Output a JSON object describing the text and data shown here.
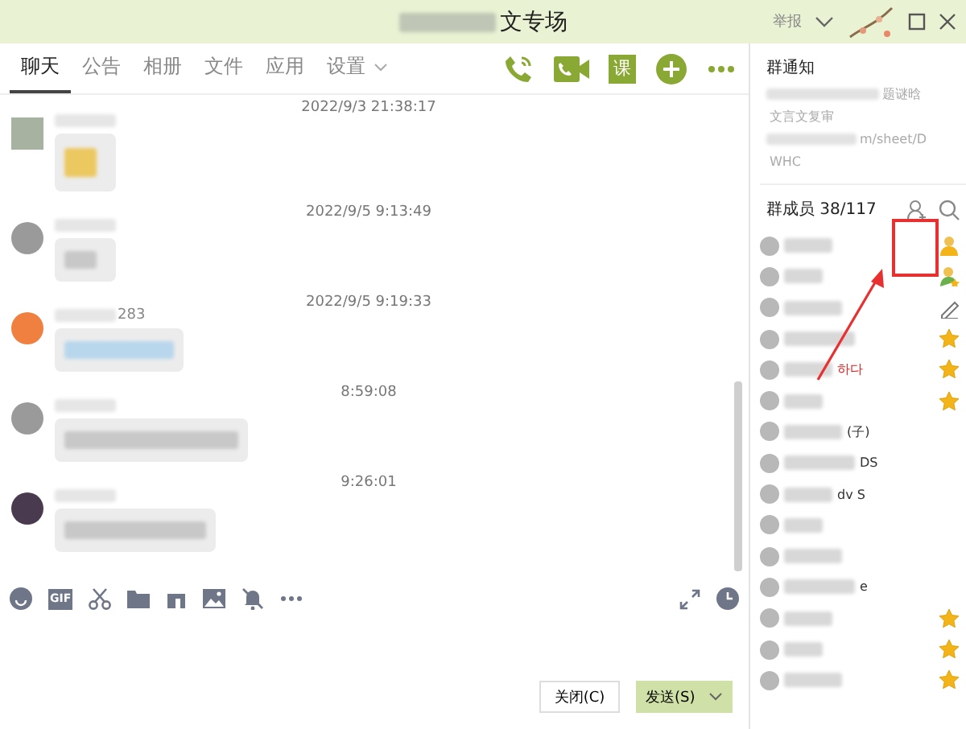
{
  "window": {
    "title": "文专场",
    "report": "举报"
  },
  "tabs": [
    {
      "label": "聊天",
      "selected": true
    },
    {
      "label": "公告",
      "selected": false
    },
    {
      "label": "相册",
      "selected": false
    },
    {
      "label": "文件",
      "selected": false
    },
    {
      "label": "应用",
      "selected": false
    },
    {
      "label": "设置",
      "selected": false,
      "dropdown": true
    }
  ],
  "header_actions": [
    {
      "kind": "call"
    },
    {
      "kind": "video"
    },
    {
      "kind": "class",
      "label": "课"
    },
    {
      "kind": "add"
    },
    {
      "kind": "more"
    }
  ],
  "messages": [
    {
      "time": "2022/9/3 21:38:17"
    },
    {
      "time": "2022/9/5 9:13:49"
    },
    {
      "time": "2022/9/5 9:19:33",
      "sender": "283"
    },
    {
      "time": "8:59:08"
    },
    {
      "time": "9:26:01"
    }
  ],
  "toolbar": [
    {
      "kind": "emoji"
    },
    {
      "kind": "gif",
      "label": "GIF"
    },
    {
      "kind": "scissors"
    },
    {
      "kind": "folder"
    },
    {
      "kind": "music"
    },
    {
      "kind": "image"
    },
    {
      "kind": "bell"
    },
    {
      "kind": "more"
    }
  ],
  "buttons": {
    "close": "关闭(C)",
    "send": "发送(S)"
  },
  "notice": {
    "title": "群通知",
    "lines": [
      "题谜晗",
      "文言文复审",
      "m/sheet/D",
      "WHC"
    ]
  },
  "members": {
    "title": "群成员 38/117",
    "items": [
      {
        "kind": "owner"
      },
      {
        "kind": "admin"
      },
      {
        "kind": "pencil"
      },
      {
        "kind": "star"
      },
      {
        "name": "하다",
        "kind": "star",
        "red": true
      },
      {
        "kind": "star"
      },
      {
        "name": "(子)",
        "kind": "plain"
      },
      {
        "name": "DS",
        "kind": "plain"
      },
      {
        "name": "dv S",
        "kind": "plain"
      },
      {
        "kind": "plain"
      },
      {
        "kind": "plain"
      },
      {
        "name": "e",
        "kind": "plain"
      },
      {
        "kind": "star"
      },
      {
        "kind": "star"
      },
      {
        "kind": "star"
      }
    ]
  }
}
